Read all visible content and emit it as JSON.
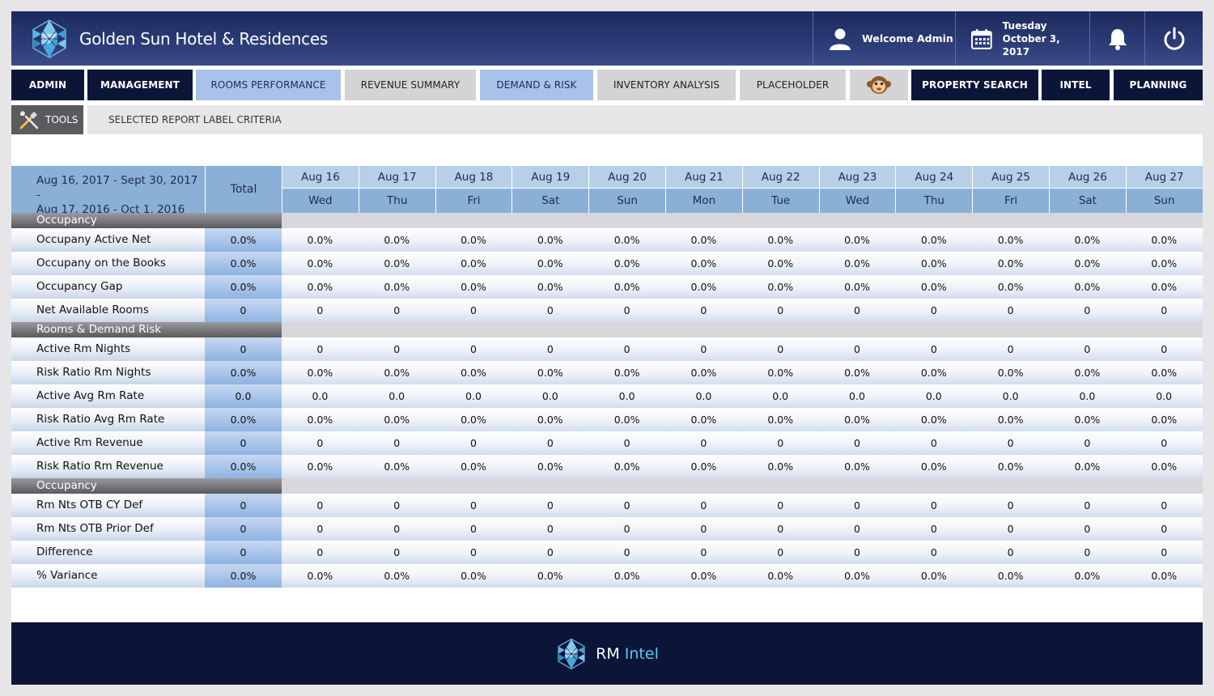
{
  "header": {
    "title": "Golden Sun Hotel & Residences",
    "welcome": "Welcome Admin",
    "date_day": "Tuesday",
    "date_full": "October 3, 2017"
  },
  "nav": {
    "tabs": [
      {
        "label": "ADMIN",
        "style": "dark"
      },
      {
        "label": "MANAGEMENT",
        "style": "dark"
      },
      {
        "label": "ROOMS PERFORMANCE",
        "style": "light"
      },
      {
        "label": "REVENUE SUMMARY",
        "style": "grey"
      },
      {
        "label": "DEMAND & RISK",
        "style": "light"
      },
      {
        "label": "INVENTORY ANALYSIS",
        "style": "grey"
      },
      {
        "label": "PLACEHOLDER",
        "style": "grey"
      },
      {
        "label": "",
        "style": "grey",
        "icon": "monkey-icon"
      },
      {
        "label": "PROPERTY SEARCH",
        "style": "dark"
      },
      {
        "label": "INTEL",
        "style": "dark"
      },
      {
        "label": "PLANNING",
        "style": "dark"
      }
    ]
  },
  "toolbar": {
    "tools_label": "TOOLS",
    "criteria_label": "SELECTED REPORT LABEL CRITERIA"
  },
  "table": {
    "range_line1": "Aug 16, 2017 - Sept 30, 2017 -",
    "range_line2": "Aug 17, 2016 - Oct 1, 2016",
    "total_label": "Total",
    "days": [
      {
        "date": "Aug 16",
        "dow": "Wed"
      },
      {
        "date": "Aug 17",
        "dow": "Thu"
      },
      {
        "date": "Aug 18",
        "dow": "Fri"
      },
      {
        "date": "Aug 19",
        "dow": "Sat"
      },
      {
        "date": "Aug 20",
        "dow": "Sun"
      },
      {
        "date": "Aug 21",
        "dow": "Mon"
      },
      {
        "date": "Aug 22",
        "dow": "Tue"
      },
      {
        "date": "Aug 23",
        "dow": "Wed"
      },
      {
        "date": "Aug 24",
        "dow": "Thu"
      },
      {
        "date": "Aug 25",
        "dow": "Fri"
      },
      {
        "date": "Aug 26",
        "dow": "Sat"
      },
      {
        "date": "Aug 27",
        "dow": "Sun"
      }
    ],
    "sections": [
      {
        "title": "Occupancy",
        "rows": [
          {
            "label": "Occupany Active Net",
            "total": "0.0%",
            "values": [
              "0.0%",
              "0.0%",
              "0.0%",
              "0.0%",
              "0.0%",
              "0.0%",
              "0.0%",
              "0.0%",
              "0.0%",
              "0.0%",
              "0.0%",
              "0.0%"
            ]
          },
          {
            "label": "Occupany on the Books",
            "total": "0.0%",
            "values": [
              "0.0%",
              "0.0%",
              "0.0%",
              "0.0%",
              "0.0%",
              "0.0%",
              "0.0%",
              "0.0%",
              "0.0%",
              "0.0%",
              "0.0%",
              "0.0%"
            ]
          },
          {
            "label": "Occupancy Gap",
            "total": "0.0%",
            "values": [
              "0.0%",
              "0.0%",
              "0.0%",
              "0.0%",
              "0.0%",
              "0.0%",
              "0.0%",
              "0.0%",
              "0.0%",
              "0.0%",
              "0.0%",
              "0.0%"
            ]
          },
          {
            "label": "Net Available Rooms",
            "total": "0",
            "values": [
              "0",
              "0",
              "0",
              "0",
              "0",
              "0",
              "0",
              "0",
              "0",
              "0",
              "0",
              "0"
            ]
          }
        ]
      },
      {
        "title": "Rooms & Demand Risk",
        "rows": [
          {
            "label": "Active Rm Nights",
            "total": "0",
            "values": [
              "0",
              "0",
              "0",
              "0",
              "0",
              "0",
              "0",
              "0",
              "0",
              "0",
              "0",
              "0"
            ]
          },
          {
            "label": "Risk Ratio Rm Nights",
            "total": "0.0%",
            "values": [
              "0.0%",
              "0.0%",
              "0.0%",
              "0.0%",
              "0.0%",
              "0.0%",
              "0.0%",
              "0.0%",
              "0.0%",
              "0.0%",
              "0.0%",
              "0.0%"
            ]
          },
          {
            "label": "Active Avg Rm Rate",
            "total": "0.0",
            "values": [
              "0.0",
              "0.0",
              "0.0",
              "0.0",
              "0.0",
              "0.0",
              "0.0",
              "0.0",
              "0.0",
              "0.0",
              "0.0",
              "0.0"
            ]
          },
          {
            "label": "Risk Ratio Avg Rm Rate",
            "total": "0.0%",
            "values": [
              "0.0%",
              "0.0%",
              "0.0%",
              "0.0%",
              "0.0%",
              "0.0%",
              "0.0%",
              "0.0%",
              "0.0%",
              "0.0%",
              "0.0%",
              "0.0%"
            ]
          },
          {
            "label": "Active Rm Revenue",
            "total": "0",
            "values": [
              "0",
              "0",
              "0",
              "0",
              "0",
              "0",
              "0",
              "0",
              "0",
              "0",
              "0",
              "0"
            ]
          },
          {
            "label": "Risk Ratio Rm Revenue",
            "total": "0.0%",
            "values": [
              "0.0%",
              "0.0%",
              "0.0%",
              "0.0%",
              "0.0%",
              "0.0%",
              "0.0%",
              "0.0%",
              "0.0%",
              "0.0%",
              "0.0%",
              "0.0%"
            ]
          }
        ]
      },
      {
        "title": "Occupancy",
        "rows": [
          {
            "label": "Rm Nts OTB CY Def",
            "total": "0",
            "values": [
              "0",
              "0",
              "0",
              "0",
              "0",
              "0",
              "0",
              "0",
              "0",
              "0",
              "0",
              "0"
            ]
          },
          {
            "label": "Rm Nts OTB Prior Def",
            "total": "0",
            "values": [
              "0",
              "0",
              "0",
              "0",
              "0",
              "0",
              "0",
              "0",
              "0",
              "0",
              "0",
              "0"
            ]
          },
          {
            "label": "Difference",
            "total": "0",
            "values": [
              "0",
              "0",
              "0",
              "0",
              "0",
              "0",
              "0",
              "0",
              "0",
              "0",
              "0",
              "0"
            ]
          },
          {
            "label": "% Variance",
            "total": "0.0%",
            "values": [
              "0.0%",
              "0.0%",
              "0.0%",
              "0.0%",
              "0.0%",
              "0.0%",
              "0.0%",
              "0.0%",
              "0.0%",
              "0.0%",
              "0.0%",
              "0.0%"
            ]
          }
        ]
      }
    ]
  },
  "footer": {
    "brand_rm": "RM",
    "brand_intel": "Intel"
  },
  "colors": {
    "header_bg": "#2c3c76",
    "nav_dark": "#0b1538",
    "nav_light": "#a8c2ea",
    "accent_cyan": "#5bc8ea"
  }
}
